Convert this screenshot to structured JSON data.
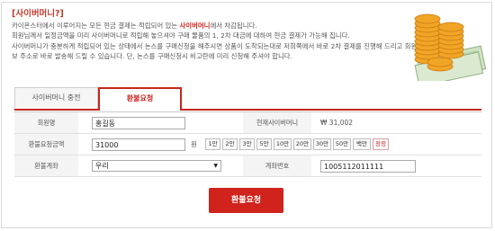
{
  "info": {
    "title": "[사이버머니?]",
    "line1_pre": "카이온스터에서 이루어지는 모든 현금 결제는 적립되어 있는 ",
    "line1_hl": "사이버머니",
    "line1_post": "에서 차감됩니다.",
    "line2": "회원님께서 일정금액을 미리 사이버머니로 적립해 놓으셔야 구매 물품의 1, 2차 대금에 대하여 현금 결제가 가능해 집니다.",
    "line3": "사이버머니가 충분하게 적립되어 있는 상태에서 논스를 구매신청을 해주시면 상품이 도착되는대로 저희쪽에서 바로 2차 결제를 진행해 드리고 회원정보 주소로 바로 발송해 드릴 수 있습니다. 단, 논스를 구매신청시 비고란에 미리 신청해 주셔야 합니다."
  },
  "tabs": [
    {
      "label": "사이버머니 충전"
    },
    {
      "label": "환불요청"
    }
  ],
  "form": {
    "name_label": "회원명",
    "name_value": "홍길동",
    "balance_label": "현재사이버머니",
    "balance_value": "₩ 31,002",
    "amount_label": "환불요청금액",
    "amount_value": "31000",
    "amount_unit": "원",
    "amount_buttons": [
      "1만",
      "2만",
      "3만",
      "5만",
      "10만",
      "20만",
      "30만",
      "50만",
      "백만"
    ],
    "reset_label": "정정",
    "bank_label": "환불계좌",
    "bank_value": "우리",
    "account_label": "계좌번호",
    "account_value": "1005112011111"
  },
  "submit_label": "환불요청",
  "colors": {
    "accent": "#c8251d",
    "button": "#d0231c"
  }
}
